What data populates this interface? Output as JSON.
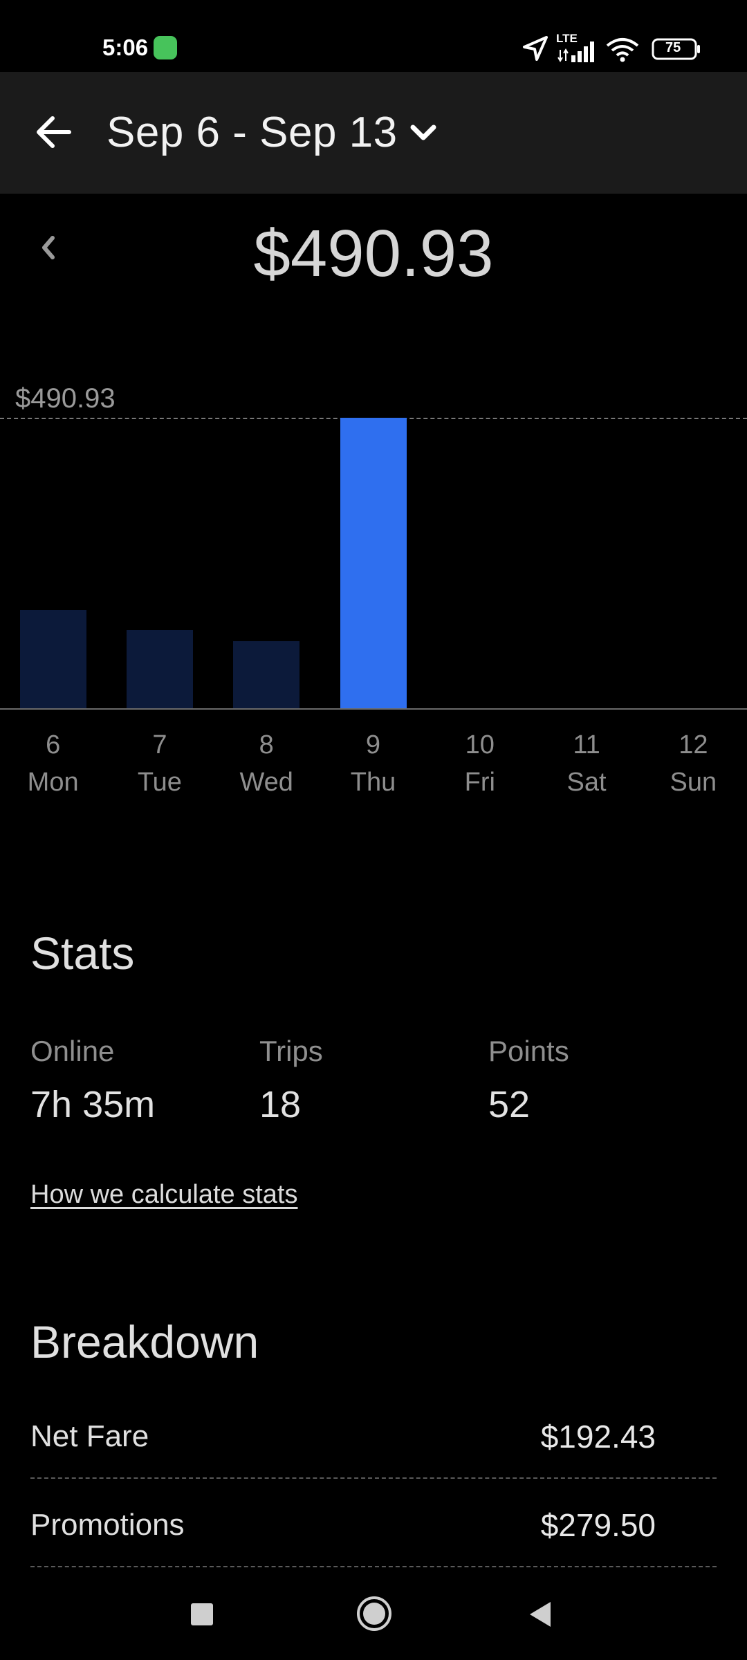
{
  "status_bar": {
    "time": "5:06",
    "network": "LTE",
    "battery": "75",
    "icons": [
      "app-notification-icon",
      "location-icon",
      "signal-icon",
      "wifi-icon",
      "battery-icon"
    ]
  },
  "header": {
    "title": "Sep 6 - Sep 13",
    "back_icon": "back-arrow-icon",
    "dropdown_icon": "chevron-down-icon"
  },
  "total": {
    "amount": "$490.93",
    "prev_icon": "chevron-left-icon"
  },
  "chart_data": {
    "type": "bar",
    "categories": [
      "6 Mon",
      "7 Tue",
      "8 Wed",
      "9 Thu",
      "10 Fri",
      "11 Sat",
      "12 Sun"
    ],
    "days": [
      {
        "date": "6",
        "weekday": "Mon"
      },
      {
        "date": "7",
        "weekday": "Tue"
      },
      {
        "date": "8",
        "weekday": "Wed"
      },
      {
        "date": "9",
        "weekday": "Thu"
      },
      {
        "date": "10",
        "weekday": "Fri"
      },
      {
        "date": "11",
        "weekday": "Sat"
      },
      {
        "date": "12",
        "weekday": "Sun"
      }
    ],
    "values": [
      166,
      132,
      113,
      490.93,
      0,
      0,
      0
    ],
    "max_label": "$490.93",
    "ylim": [
      0,
      490.93
    ],
    "highlight_index": 3,
    "colors": {
      "highlight": "#2f6fef",
      "normal": "#0c1a3a",
      "gridline": "#777777"
    }
  },
  "stats": {
    "title": "Stats",
    "items": [
      {
        "label": "Online",
        "value": "7h 35m"
      },
      {
        "label": "Trips",
        "value": "18"
      },
      {
        "label": "Points",
        "value": "52"
      }
    ],
    "link": "How we calculate stats"
  },
  "breakdown": {
    "title": "Breakdown",
    "rows": [
      {
        "label": "Net Fare",
        "value": "$192.43"
      },
      {
        "label": "Promotions",
        "value": "$279.50"
      }
    ]
  },
  "nav_bar": {
    "icons": [
      "recents-square-icon",
      "home-circle-icon",
      "back-triangle-icon"
    ]
  }
}
